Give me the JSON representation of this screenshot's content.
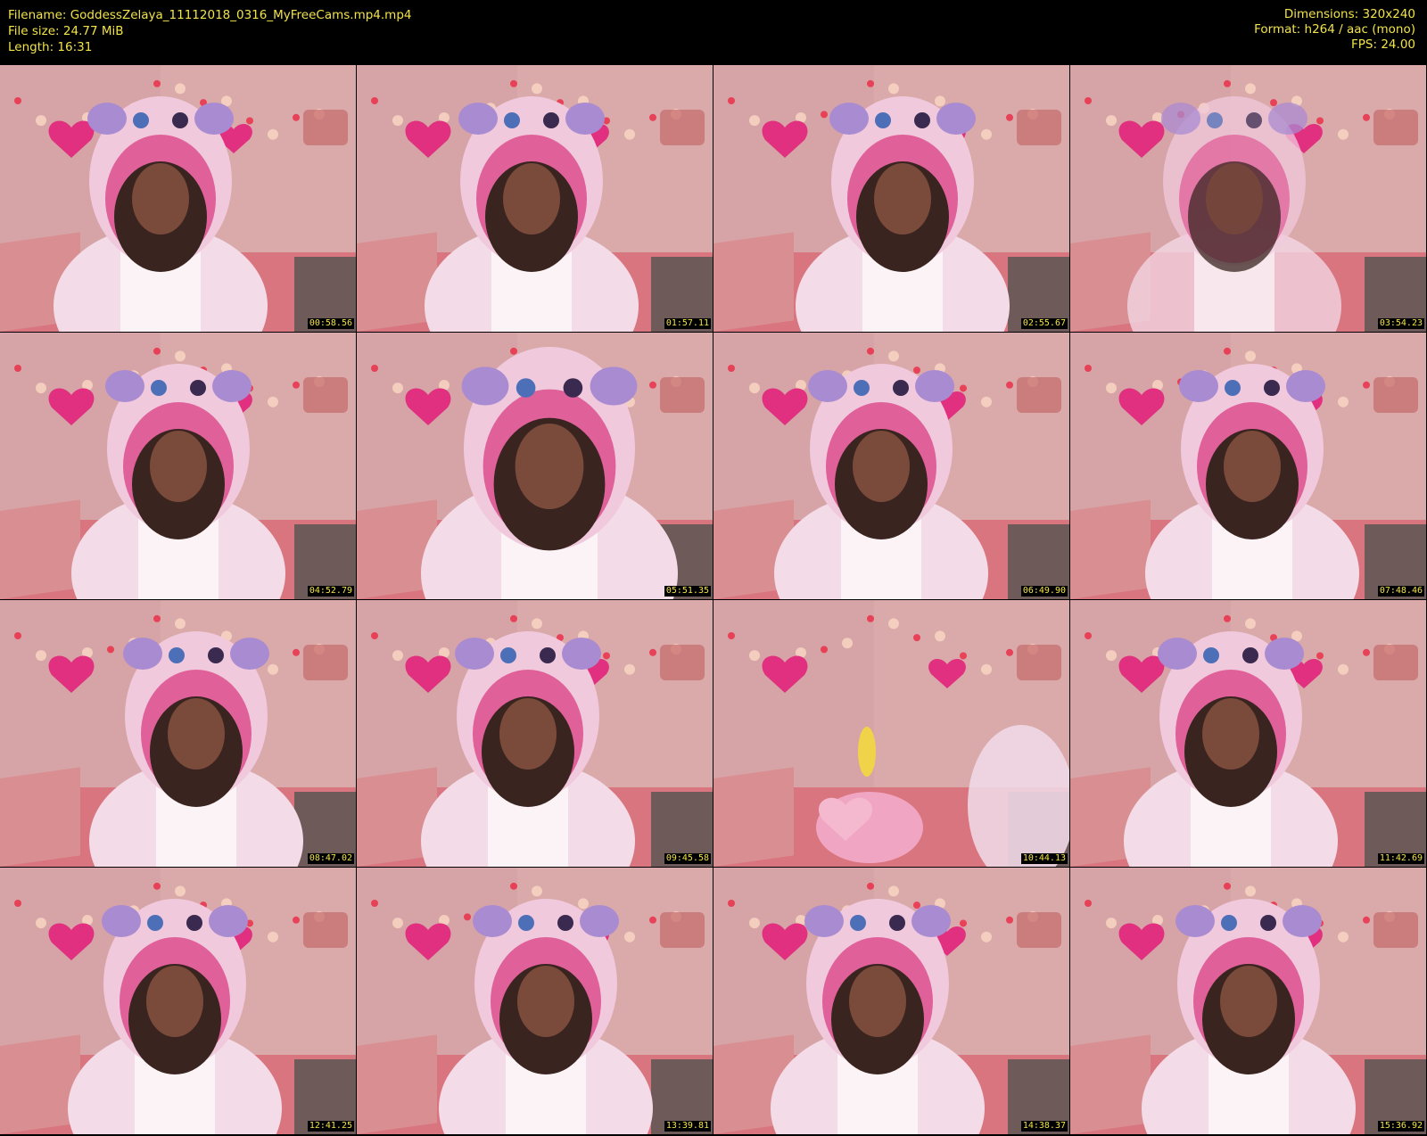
{
  "header": {
    "filename": "Filename: GoddessZelaya_11112018_0316_MyFreeCams.mp4.mp4",
    "filesize": "File size: 24.77 MiB",
    "length": "Length: 16:31",
    "dimensions": "Dimensions: 320x240",
    "format": "Format: h264 / aac (mono)",
    "fps": "FPS: 24.00"
  },
  "colors": {
    "text": "#f2e34a",
    "background": "#000000",
    "wall": "#d9a9aa",
    "hood": "#f0c9dc",
    "hood_lining": "#e0609a",
    "heart": "#e0307f"
  },
  "frames": [
    {
      "timestamp": "00:58.56",
      "variant": "person"
    },
    {
      "timestamp": "01:57.11",
      "variant": "person"
    },
    {
      "timestamp": "02:55.67",
      "variant": "person"
    },
    {
      "timestamp": "03:54.23",
      "variant": "person-blur"
    },
    {
      "timestamp": "04:52.79",
      "variant": "person"
    },
    {
      "timestamp": "05:51.35",
      "variant": "person-close"
    },
    {
      "timestamp": "06:49.90",
      "variant": "person"
    },
    {
      "timestamp": "07:48.46",
      "variant": "person"
    },
    {
      "timestamp": "08:47.02",
      "variant": "person"
    },
    {
      "timestamp": "09:45.58",
      "variant": "person"
    },
    {
      "timestamp": "10:44.13",
      "variant": "empty-room"
    },
    {
      "timestamp": "11:42.69",
      "variant": "person"
    },
    {
      "timestamp": "12:41.25",
      "variant": "person"
    },
    {
      "timestamp": "13:39.81",
      "variant": "person"
    },
    {
      "timestamp": "14:38.37",
      "variant": "person"
    },
    {
      "timestamp": "15:36.92",
      "variant": "person"
    }
  ]
}
